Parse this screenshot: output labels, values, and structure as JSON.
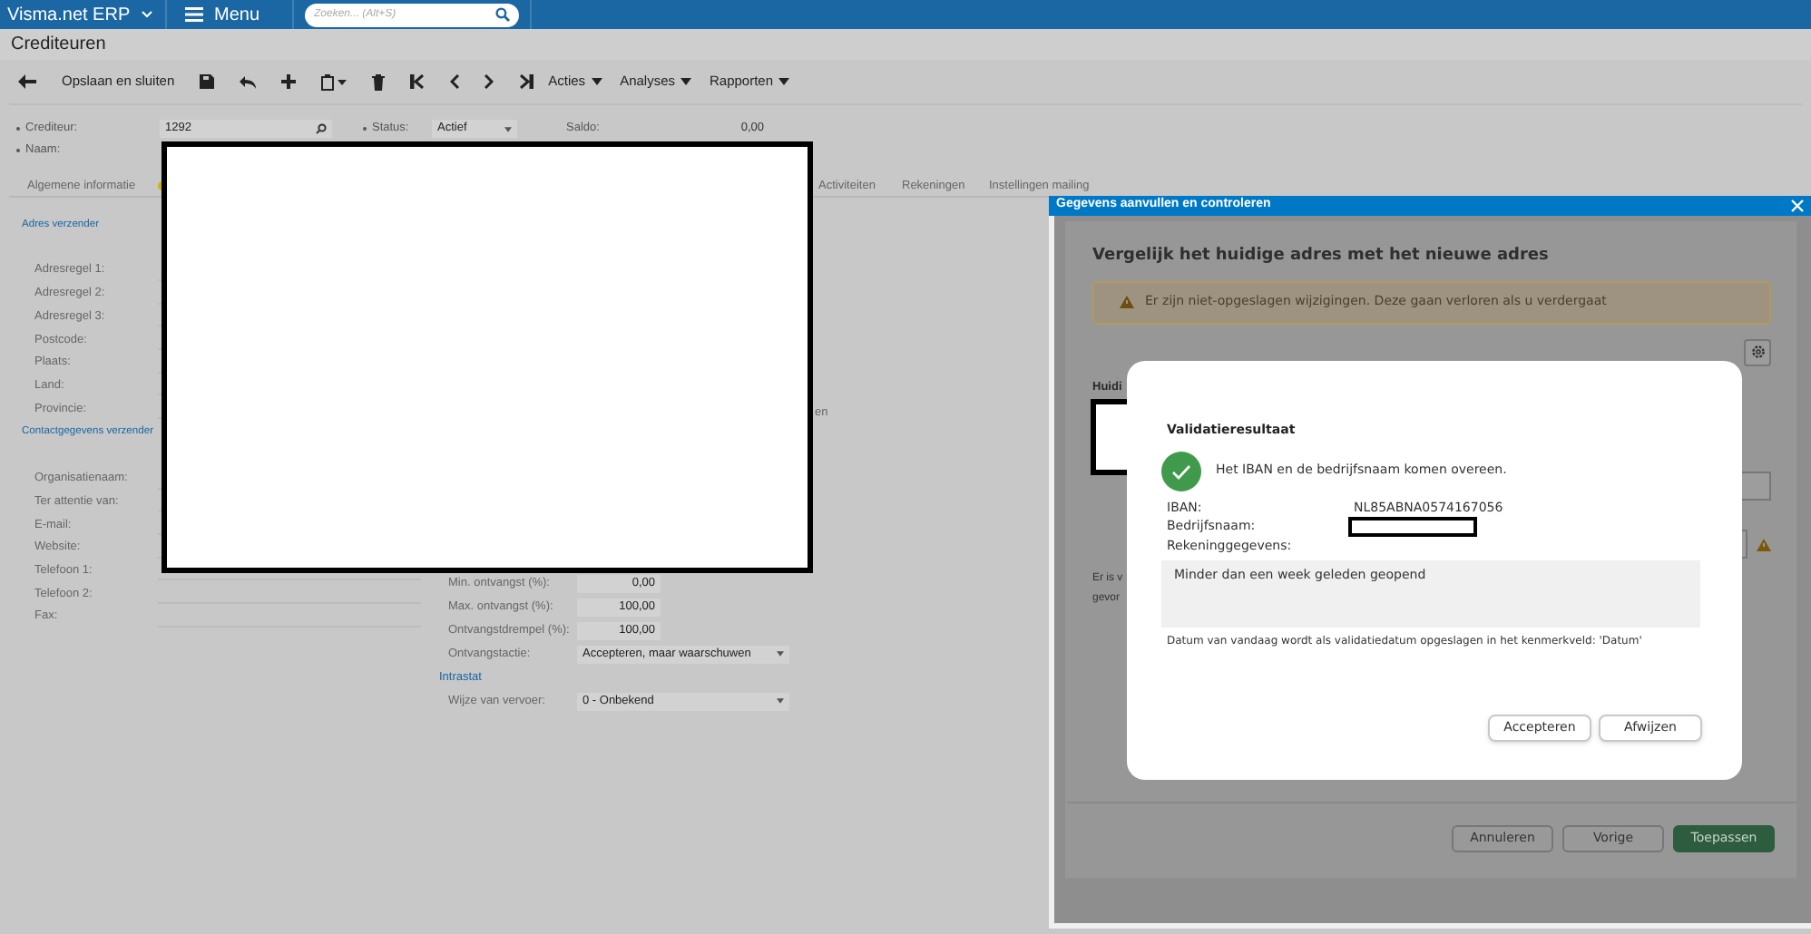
{
  "topbar": {
    "brand": "Visma.net ERP",
    "menu": "Menu",
    "search": {
      "placeholder": "Zoeken... (Alt+S)"
    }
  },
  "page_title": "Crediteuren",
  "toolbar": {
    "save_close": "Opslaan en sluiten",
    "menus": [
      "Acties",
      "Analyses",
      "Rapporten"
    ]
  },
  "header_fields": [
    {
      "label": "Crediteur:",
      "value": "1292",
      "kind": "lookup",
      "required": true
    },
    {
      "label": "Status:",
      "value": "Actief",
      "kind": "select",
      "required": true
    },
    {
      "label": "Saldo:",
      "value": "0,00",
      "kind": "readonly",
      "required": false
    },
    {
      "label": "Naam:",
      "kind": "text",
      "required": true
    }
  ],
  "tabs": [
    {
      "label": "Algemene informatie",
      "selected": false
    },
    {
      "label": "Activiteiten",
      "selected": false
    },
    {
      "label": "Rekeningen",
      "selected": false
    },
    {
      "label": "Instellingen mailing",
      "selected": false
    }
  ],
  "address_section": {
    "title": "Adres verzender",
    "labels": [
      "Adresregel 1:",
      "Adresregel 2:",
      "Adresregel 3:",
      "Postcode:",
      "Plaats:",
      "Land:",
      "Provincie:"
    ]
  },
  "contact_section": {
    "title": "Contactgegevens verzender",
    "labels": [
      "Organisatienaam:",
      "Ter attentie van:",
      "E-mail:",
      "Website:",
      "Telefoon 1:",
      "Telefoon 2:",
      "Fax:"
    ]
  },
  "receipt_fields": [
    {
      "label": "Min. ontvangst (%):",
      "value": "0,00",
      "kind": "number"
    },
    {
      "label": "Max. ontvangst (%):",
      "value": "100,00",
      "kind": "number"
    },
    {
      "label": "Ontvangstdrempel (%):",
      "value": "100,00",
      "kind": "number"
    },
    {
      "label": "Ontvangstactie:",
      "value": "Accepteren, maar waarschuwen",
      "kind": "select"
    }
  ],
  "intrastat": {
    "title": "Intrastat",
    "fields": [
      {
        "label": "Wijze van vervoer:",
        "value": "0 - Onbekend",
        "kind": "select"
      }
    ]
  },
  "fragment_text": "en",
  "dialog": {
    "title": "Gegevens aanvullen en controleren",
    "heading": "Vergelijk het huidige adres met het nieuwe adres",
    "warning": "Er zijn niet-opgeslagen wijzigingen. Deze gaan verloren als u verdergaat",
    "section_label": "Huidi",
    "notice_lines": [
      "Er is v",
      "gevor"
    ],
    "buttons": [
      {
        "label": "Annuleren",
        "primary": false
      },
      {
        "label": "Vorige",
        "primary": false
      },
      {
        "label": "Toepassen",
        "primary": true
      }
    ]
  },
  "validation": {
    "title": "Validatieresultaat",
    "message": "Het IBAN en de bedrijfsnaam komen overeen.",
    "iban_label": "IBAN:",
    "iban": "NL85ABNA0574167056",
    "company_label": "Bedrijfsnaam:",
    "account_label": "Rekeninggegevens:",
    "account_info": "Minder dan een week geleden geopend",
    "note": "Datum van vandaag wordt als validatiedatum opgeslagen in het kenmerkveld: 'Datum'",
    "buttons": [
      "Accepteren",
      "Afwijzen"
    ]
  }
}
